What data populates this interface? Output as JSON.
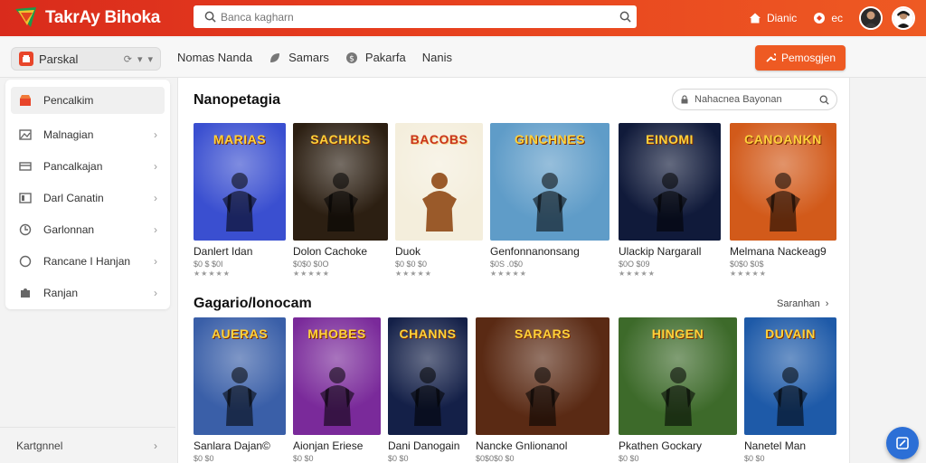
{
  "header": {
    "brand": "TakrAy Bihoka",
    "search_placeholder": "Banca kagharn",
    "right_label": "Dianic",
    "right_badge": "ec",
    "colors": {
      "bar_start": "#d92b1c",
      "bar_end": "#ee5a23"
    }
  },
  "nav": {
    "selector_label": "Parskal",
    "links": [
      "Nomas Nanda",
      "Samars",
      "Pakarfa",
      "Nanis"
    ],
    "cta_label": "Pemosgjen",
    "cta_color": "#ee5a23"
  },
  "sidebar": {
    "items": [
      {
        "label": "Pencalkim",
        "icon": "store-icon",
        "active": true
      },
      {
        "label": "Malnagian",
        "icon": "image-icon"
      },
      {
        "label": "Pancalkajan",
        "icon": "card-icon"
      },
      {
        "label": "Darl Canatin",
        "icon": "bookmark-icon"
      },
      {
        "label": "Garlonnan",
        "icon": "gamepad-icon"
      },
      {
        "label": "Rancane I Hanjan",
        "icon": "circle-icon"
      },
      {
        "label": "Ranjan",
        "icon": "puzzle-icon"
      }
    ],
    "footer_label": "Kartgnnel"
  },
  "main": {
    "section1": {
      "title": "Nanopetagia",
      "search_placeholder": "Nahacnea Bayonan",
      "cards": [
        {
          "title": "Danlert Idan",
          "price": "$0 $ $0I",
          "stars": "★★★★★",
          "art": "MARIAS",
          "bg": "#3a4fd0"
        },
        {
          "title": "Dolon Cachoke",
          "price": "$0$0 $0O",
          "stars": "★★★★★",
          "art": "SACHKIS",
          "bg": "#2c1f12"
        },
        {
          "title": "Duok",
          "price": "$0 $0 $0",
          "stars": "★★★★★",
          "art": "BACOBS",
          "bg": "#f4eedc"
        },
        {
          "title": "Genfonnanonsang",
          "price": "$0S .0$0",
          "stars": "★★★★★",
          "art": "GINCHNES",
          "bg": "#5f9cc8"
        },
        {
          "title": "Ulackip Nargarall",
          "price": "$0O $09",
          "stars": "★★★★★",
          "art": "EINOMI",
          "bg": "#101a3a"
        },
        {
          "title": "Melmana Nackeag9",
          "price": "$0$0 $0$",
          "stars": "★★★★★",
          "art": "CANOANKN",
          "bg": "#d25a1a"
        }
      ]
    },
    "section2": {
      "title": "Gagario/lonocam",
      "see_all": "Saranhan",
      "cards": [
        {
          "title": "Sanlara Dajan©",
          "price": "$0 $0",
          "art": "AUERAS",
          "bg": "#3a5fa8"
        },
        {
          "title": "Aionjan Eriese",
          "price": "$0 $0",
          "art": "MHOBES",
          "bg": "#7a2a9a"
        },
        {
          "title": "Dani Danogain",
          "price": "$0 $0",
          "art": "CHANNS",
          "bg": "#142048"
        },
        {
          "title": "Nancke Gnlionanol",
          "price": "$0$0$0 $0",
          "art": "SARARS",
          "bg": "#5a2a14"
        },
        {
          "title": "Pkathen Gockary",
          "price": "$0 $0",
          "art": "HINGEN",
          "bg": "#3d6a2a"
        },
        {
          "title": "Nanetel Man",
          "price": "$0 $0",
          "art": "DUVAIN",
          "bg": "#1e5aa8"
        }
      ]
    }
  }
}
